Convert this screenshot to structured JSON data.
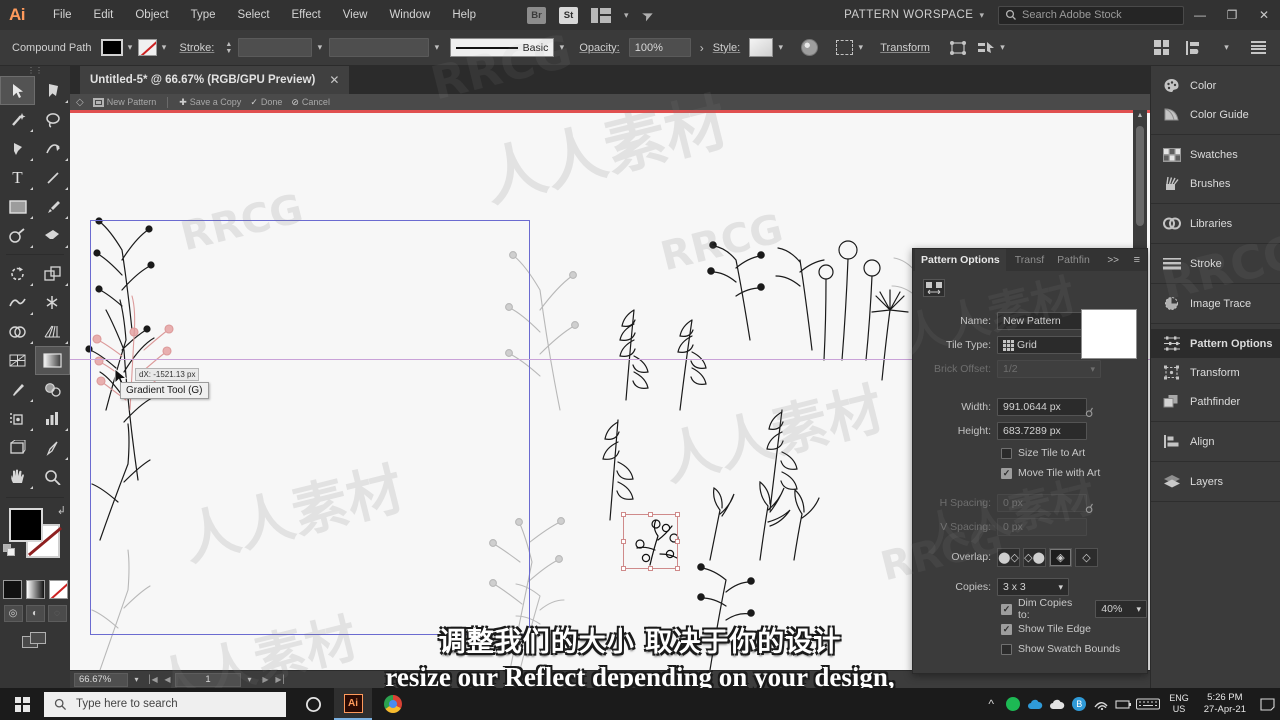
{
  "app": {
    "name": "Adobe Illustrator",
    "logo_text": "Ai",
    "workspace": "PATTERN WORSPACE",
    "stock_search_placeholder": "Search Adobe Stock"
  },
  "menubar": {
    "items": [
      "File",
      "Edit",
      "Object",
      "Type",
      "Select",
      "Effect",
      "View",
      "Window",
      "Help"
    ],
    "bridge_label": "Br",
    "stock_label": "St"
  },
  "window_controls": {
    "minimize": "—",
    "restore": "❐",
    "close": "✕"
  },
  "controlbar": {
    "object_type": "Compound Path",
    "stroke_label": "Stroke:",
    "stroke_weight": "",
    "stroke_profile": "Basic",
    "opacity_label": "Opacity:",
    "opacity_value": "100%",
    "opacity_arrow": "›",
    "style_label": "Style:",
    "transform_label": "Transform"
  },
  "document": {
    "tab_title": "Untitled-5* @ 66.67% (RGB/GPU Preview)",
    "close_glyph": "✕"
  },
  "pattern_edit_bar": {
    "pattern_name": "New Pattern",
    "save_copy": "Save a Copy",
    "done": "Done",
    "cancel": "Cancel"
  },
  "canvas": {
    "measure_tag": "dX: -1521.13 px",
    "tooltip": "Gradient Tool (G)"
  },
  "statusbar": {
    "zoom": "66.67%",
    "page": "1",
    "first_glyph": "⎮◀",
    "prev_glyph": "◀",
    "next_glyph": "▶",
    "last_glyph": "▶⎮"
  },
  "pattern_options": {
    "tabs": [
      {
        "label": "Pattern Options",
        "active": true
      },
      {
        "label": "Transf",
        "active": false
      },
      {
        "label": "Pathfin",
        "active": false
      }
    ],
    "expand_glyph": ">>",
    "menu_glyph": "≡",
    "name_label": "Name:",
    "name_value": "New Pattern",
    "tile_type_label": "Tile Type:",
    "tile_type_value": "Grid",
    "brick_offset_label": "Brick Offset:",
    "brick_offset_value": "1/2",
    "width_label": "Width:",
    "width_value": "991.0644 px",
    "height_label": "Height:",
    "height_value": "683.7289 px",
    "size_tile_to_art": {
      "label": "Size Tile to Art",
      "checked": false
    },
    "move_tile_with_art": {
      "label": "Move Tile with Art",
      "checked": true
    },
    "h_spacing_label": "H Spacing:",
    "h_spacing_value": "0 px",
    "v_spacing_label": "V Spacing:",
    "v_spacing_value": "0 px",
    "overlap_label": "Overlap:",
    "overlap_buttons": [
      "left-in-front",
      "right-in-front",
      "bottom-in-front",
      "top-in-front"
    ],
    "overlap_active": [
      2
    ],
    "copies_label": "Copies:",
    "copies_value": "3 x 3",
    "dim_copies": {
      "label": "Dim Copies to:",
      "checked": true,
      "value": "40%"
    },
    "show_tile_edge": {
      "label": "Show Tile Edge",
      "checked": true
    },
    "show_swatch_bounds": {
      "label": "Show Swatch Bounds",
      "checked": false
    }
  },
  "dock": {
    "groups": [
      [
        {
          "label": "Color",
          "icon": "color-palette-icon",
          "active": false
        },
        {
          "label": "Color Guide",
          "icon": "color-guide-icon",
          "active": false
        }
      ],
      [
        {
          "label": "Swatches",
          "icon": "swatches-icon",
          "active": false
        },
        {
          "label": "Brushes",
          "icon": "brushes-icon",
          "active": false
        }
      ],
      [
        {
          "label": "Libraries",
          "icon": "libraries-icon",
          "active": false
        }
      ],
      [
        {
          "label": "Stroke",
          "icon": "stroke-icon",
          "active": false
        }
      ],
      [
        {
          "label": "Image Trace",
          "icon": "image-trace-icon",
          "active": false
        }
      ],
      [
        {
          "label": "Pattern Options",
          "icon": "pattern-options-icon",
          "active": true
        },
        {
          "label": "Transform",
          "icon": "transform-icon",
          "active": false
        },
        {
          "label": "Pathfinder",
          "icon": "pathfinder-icon",
          "active": false
        }
      ],
      [
        {
          "label": "Align",
          "icon": "align-icon",
          "active": false
        }
      ],
      [
        {
          "label": "Layers",
          "icon": "layers-icon",
          "active": false
        }
      ]
    ]
  },
  "toolbar": {
    "tools": [
      {
        "name": "selection-tool",
        "glyph": "➤",
        "selected": true,
        "hasMore": false
      },
      {
        "name": "direct-selection-tool",
        "glyph": "➤",
        "selected": false,
        "hasMore": true
      },
      {
        "name": "magic-wand-tool",
        "glyph": "✦",
        "selected": false,
        "hasMore": true
      },
      {
        "name": "lasso-tool",
        "glyph": "⌽",
        "selected": false,
        "hasMore": false
      },
      {
        "name": "pen-tool",
        "glyph": "✒",
        "selected": false,
        "hasMore": true
      },
      {
        "name": "curvature-tool",
        "glyph": "✐",
        "selected": false,
        "hasMore": true
      },
      {
        "name": "type-tool",
        "glyph": "T",
        "selected": false,
        "hasMore": true
      },
      {
        "name": "line-segment-tool",
        "glyph": "╱",
        "selected": false,
        "hasMore": true
      },
      {
        "name": "rectangle-tool",
        "glyph": "▭",
        "selected": false,
        "hasMore": true
      },
      {
        "name": "paintbrush-tool",
        "glyph": "╱",
        "selected": false,
        "hasMore": true
      },
      {
        "name": "shaper-tool",
        "glyph": "◔",
        "selected": false,
        "hasMore": true
      },
      {
        "name": "eraser-tool",
        "glyph": "◆",
        "selected": false,
        "hasMore": true
      },
      {
        "name": "rotate-tool",
        "glyph": "↻",
        "selected": false,
        "hasMore": true
      },
      {
        "name": "scale-tool",
        "glyph": "◳",
        "selected": false,
        "hasMore": true
      },
      {
        "name": "width-tool",
        "glyph": "∿",
        "selected": false,
        "hasMore": true
      },
      {
        "name": "free-transform-tool",
        "glyph": "✶",
        "selected": false,
        "hasMore": false
      },
      {
        "name": "shape-builder-tool",
        "glyph": "◑",
        "selected": false,
        "hasMore": true
      },
      {
        "name": "perspective-grid-tool",
        "glyph": "▦",
        "selected": false,
        "hasMore": true
      },
      {
        "name": "mesh-tool",
        "glyph": "⌧",
        "selected": false,
        "hasMore": false
      },
      {
        "name": "gradient-tool",
        "glyph": "■",
        "selected": true,
        "hasMore": false
      },
      {
        "name": "eyedropper-tool",
        "glyph": "✐",
        "selected": false,
        "hasMore": true
      },
      {
        "name": "blend-tool",
        "glyph": "◎",
        "selected": false,
        "hasMore": false
      },
      {
        "name": "symbol-sprayer-tool",
        "glyph": "⚙",
        "selected": false,
        "hasMore": true
      },
      {
        "name": "column-graph-tool",
        "glyph": "‖",
        "selected": false,
        "hasMore": true
      },
      {
        "name": "artboard-tool",
        "glyph": "⬚",
        "selected": false,
        "hasMore": false
      },
      {
        "name": "slice-tool",
        "glyph": "✁",
        "selected": false,
        "hasMore": true
      },
      {
        "name": "hand-tool",
        "glyph": "✋",
        "selected": false,
        "hasMore": true
      },
      {
        "name": "zoom-tool",
        "glyph": "⚲",
        "selected": false,
        "hasMore": false
      }
    ],
    "fill_color": "#000000",
    "stroke_color": "#ffffff",
    "color_modes": [
      "color",
      "gradient",
      "none"
    ],
    "draw_modes": [
      "draw-normal",
      "draw-behind",
      "draw-inside"
    ]
  },
  "subtitles": {
    "chinese": "调整我们的大小 取决于你的设计",
    "english": "resize our Reflect depending on your design,"
  },
  "taskbar": {
    "search_placeholder": "Type here to search",
    "apps": [
      "cortana",
      "illustrator",
      "chrome"
    ],
    "language": "ENG",
    "region": "US",
    "time": "5:26 PM",
    "date": "27-Apr-21"
  },
  "watermarks": {
    "brand": "RRCG",
    "cn": "人人素材"
  },
  "colors": {
    "accent": "#ff9a5c",
    "panel_bg": "#3b3b3b",
    "canvas_bg": "#f7f7f7",
    "tile_border": "#6b6bd0",
    "selection": "#cf8a8a",
    "guide": "#c9a2d8",
    "pattern_bar_red": "#e05050"
  }
}
